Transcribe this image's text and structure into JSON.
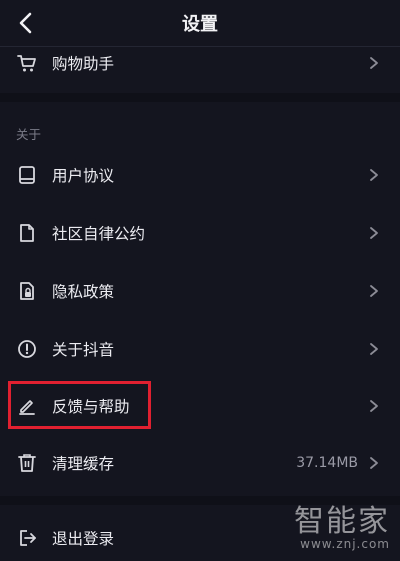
{
  "header": {
    "title": "设置"
  },
  "items": [
    {
      "label": "购物助手",
      "icon": "cart-icon"
    },
    {
      "label": "用户协议",
      "icon": "book-icon"
    },
    {
      "label": "社区自律公约",
      "icon": "document-icon"
    },
    {
      "label": "隐私政策",
      "icon": "lock-document-icon"
    },
    {
      "label": "关于抖音",
      "icon": "info-icon"
    },
    {
      "label": "反馈与帮助",
      "icon": "pencil-icon"
    },
    {
      "label": "清理缓存",
      "icon": "trash-icon",
      "value": "37.14MB"
    },
    {
      "label": "退出登录",
      "icon": "logout-icon"
    }
  ],
  "section": {
    "about": "关于"
  },
  "watermark": {
    "brand": "智能家",
    "url": "www.znj.com"
  },
  "colors": {
    "background": "#14151f",
    "highlight": "#e02030",
    "text": "#ececf1",
    "muted": "#7b7c88"
  }
}
